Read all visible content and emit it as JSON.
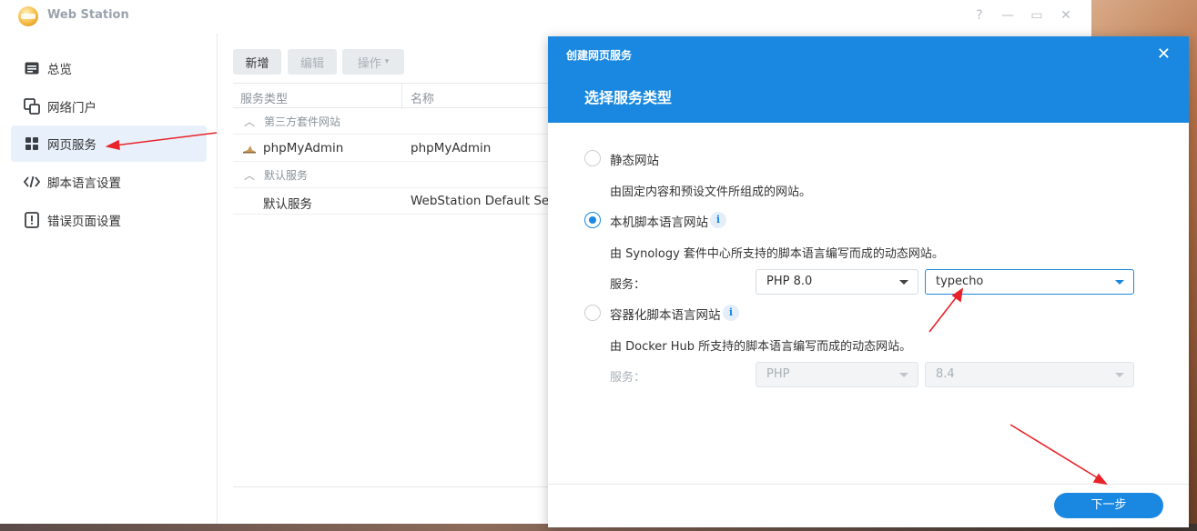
{
  "window": {
    "title": "Web Station",
    "controls": {
      "help": "?",
      "minimize": "—",
      "maximize": "▭",
      "close": "✕"
    }
  },
  "sidebar": {
    "items": [
      {
        "label": "总览",
        "icon": "overview-icon",
        "active": false
      },
      {
        "label": "网络门户",
        "icon": "portal-icon",
        "active": false
      },
      {
        "label": "网页服务",
        "icon": "web-service-icon",
        "active": true
      },
      {
        "label": "脚本语言设置",
        "icon": "code-icon",
        "active": false
      },
      {
        "label": "错误页面设置",
        "icon": "error-page-icon",
        "active": false
      }
    ]
  },
  "toolbar": {
    "add": "新增",
    "edit": "编辑",
    "action": "操作"
  },
  "table": {
    "columns": [
      "服务类型",
      "名称"
    ],
    "groups": [
      {
        "label": "第三方套件网站",
        "rows": [
          {
            "type": "phpMyAdmin",
            "name": "phpMyAdmin"
          }
        ]
      },
      {
        "label": "默认服务",
        "rows": [
          {
            "type": "默认服务",
            "name": "WebStation Default Ser"
          }
        ]
      }
    ]
  },
  "dialog": {
    "caption": "创建网页服务",
    "close": "✕",
    "title": "选择服务类型",
    "options": [
      {
        "label": "静态网站",
        "description": "由固定内容和预设文件所组成的网站。",
        "checked": false
      },
      {
        "label": "本机脚本语言网站",
        "description": "由 Synology 套件中心所支持的脚本语言编写而成的动态网站。",
        "checked": true,
        "service_label": "服务：",
        "service_value": "PHP 8.0",
        "app_value": "typecho"
      },
      {
        "label": "容器化脚本语言网站",
        "description": "由 Docker Hub 所支持的脚本语言编写而成的动态网站。",
        "checked": false,
        "service_label": "服务：",
        "service_value": "PHP",
        "app_value": "8.4"
      }
    ],
    "next": "下一步"
  },
  "colors": {
    "accent": "#1a88e0",
    "annotation_arrow": "#e8232a"
  }
}
